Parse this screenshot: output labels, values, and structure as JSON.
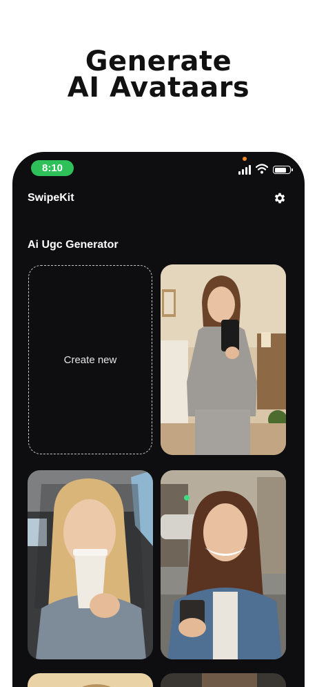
{
  "promo": {
    "headline_line1": "Generate",
    "headline_line2": "AI Avataars"
  },
  "status_bar": {
    "time": "8:10",
    "time_pill_color": "#2ec15a",
    "icons": [
      "signal-icon",
      "wifi-icon",
      "battery-icon"
    ]
  },
  "app": {
    "title": "SwipeKit",
    "settings_icon": "gear-icon"
  },
  "section": {
    "title": "Ai Ugc Generator"
  },
  "grid": {
    "create_label": "Create new",
    "avatars": [
      {
        "name": "avatar-mirror-selfie-hoodie"
      },
      {
        "name": "avatar-coffee-car"
      },
      {
        "name": "avatar-street-denim-jacket"
      },
      {
        "name": "avatar-partial-left"
      },
      {
        "name": "avatar-partial-right"
      }
    ]
  },
  "colors": {
    "phone_bg": "#0e0e10",
    "page_bg": "#ffffff"
  }
}
